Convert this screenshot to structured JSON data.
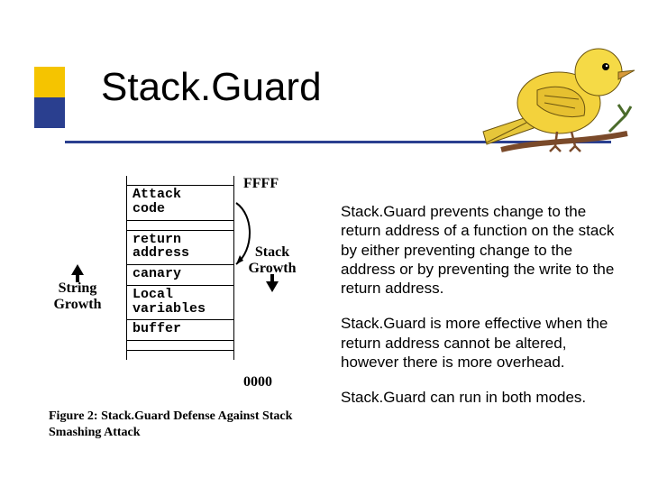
{
  "title": "Stack.Guard",
  "bird_name": "canary-bird",
  "diagram": {
    "left_label_line1": "String",
    "left_label_line2": "Growth",
    "right_label_line1": "Stack",
    "right_label_line2": "Growth",
    "addr_top": "FFFF",
    "addr_bot": "0000",
    "cells": {
      "attack_l1": "Attack",
      "attack_l2": "code",
      "ret_l1": "return",
      "ret_l2": "address",
      "canary": "canary",
      "local_l1": "Local",
      "local_l2": "variables",
      "buffer": "buffer"
    },
    "caption_prefix": "Figure 2:",
    "caption_text": "Stack.Guard Defense Against Stack Smashing Attack"
  },
  "paragraphs": {
    "p1": "Stack.Guard prevents change to the return address of a function on the stack by either preventing change to the address or by preventing the write to the return address.",
    "p2": "Stack.Guard is more effective when the return address cannot be altered, however there is more overhead.",
    "p3": "Stack.Guard can run in both modes."
  }
}
